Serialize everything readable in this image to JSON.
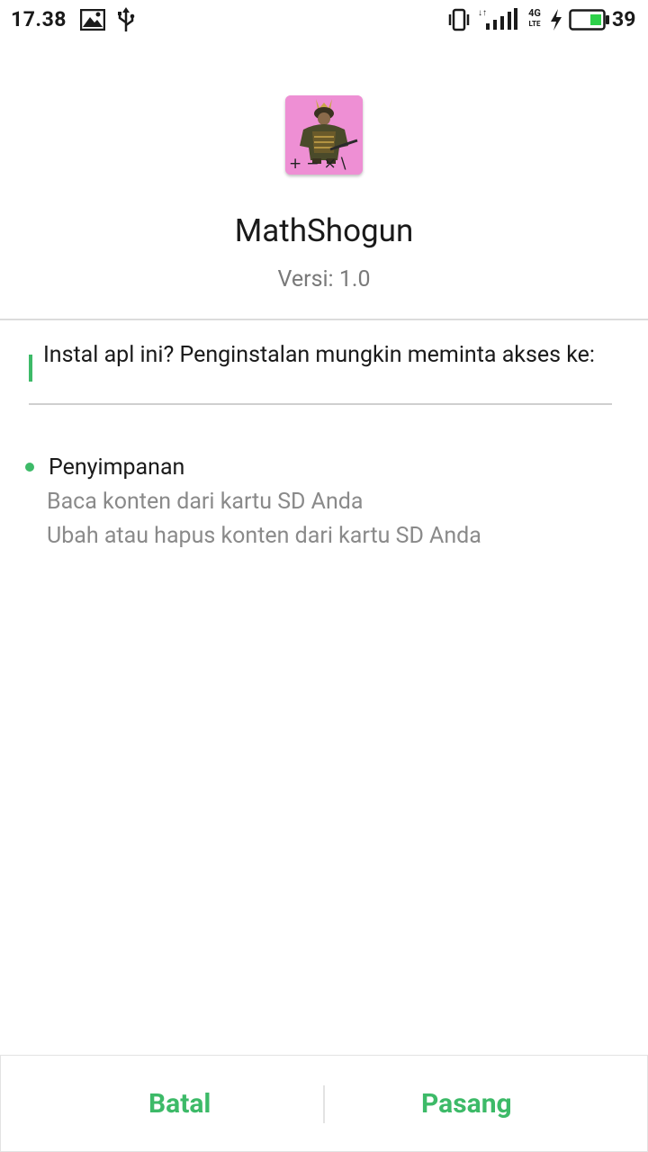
{
  "status_bar": {
    "time": "17.38",
    "battery_level": "39",
    "network_label_top": "4G",
    "network_label_bottom": "LTE",
    "icons": [
      "image-icon",
      "usb-icon",
      "vibrate-icon",
      "signal-icon",
      "network-4g-lte-icon",
      "charging-icon",
      "battery-icon"
    ]
  },
  "app": {
    "name": "MathShogun",
    "version": "Versi: 1.0",
    "icon_glyphs": "+−×\\"
  },
  "prompt": {
    "text": "Instal apl ini? Penginstalan mungkin meminta akses ke:"
  },
  "permissions": [
    {
      "group": "Penyimpanan",
      "items": [
        "Baca konten dari kartu SD Anda",
        "Ubah atau hapus konten dari kartu SD Anda"
      ]
    }
  ],
  "actions": {
    "cancel_label": "Batal",
    "install_label": "Pasang"
  },
  "colors": {
    "accent": "#3dba68",
    "icon_bg": "#ee8fd4"
  }
}
